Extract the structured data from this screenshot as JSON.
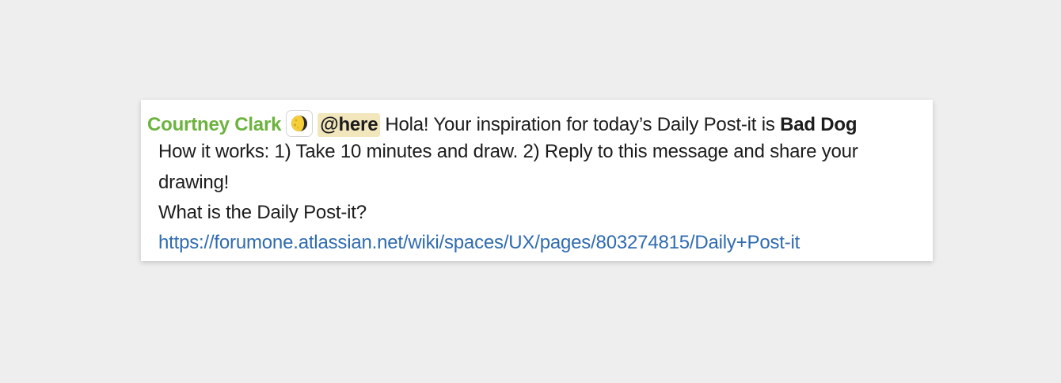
{
  "message": {
    "author": "Courtney Clark",
    "status_icon": "moon-icon",
    "mention": "@here",
    "intro_text": "Hola! Your inspiration for today’s Daily Post-it is",
    "theme": "Bad Dog",
    "line2": "How it works: 1) Take 10 minutes and draw. 2) Reply to this message and share your",
    "line3": "drawing!",
    "line4": "What is the Daily Post-it?",
    "link": "https://forumone.atlassian.net/wiki/spaces/UX/pages/803274815/Daily+Post-it"
  },
  "colors": {
    "background": "#eeeeee",
    "card": "#ffffff",
    "author": "#6cb33e",
    "mention_bg": "#f2e6bd",
    "link": "#2f6bb0",
    "text": "#1d1c1d"
  }
}
